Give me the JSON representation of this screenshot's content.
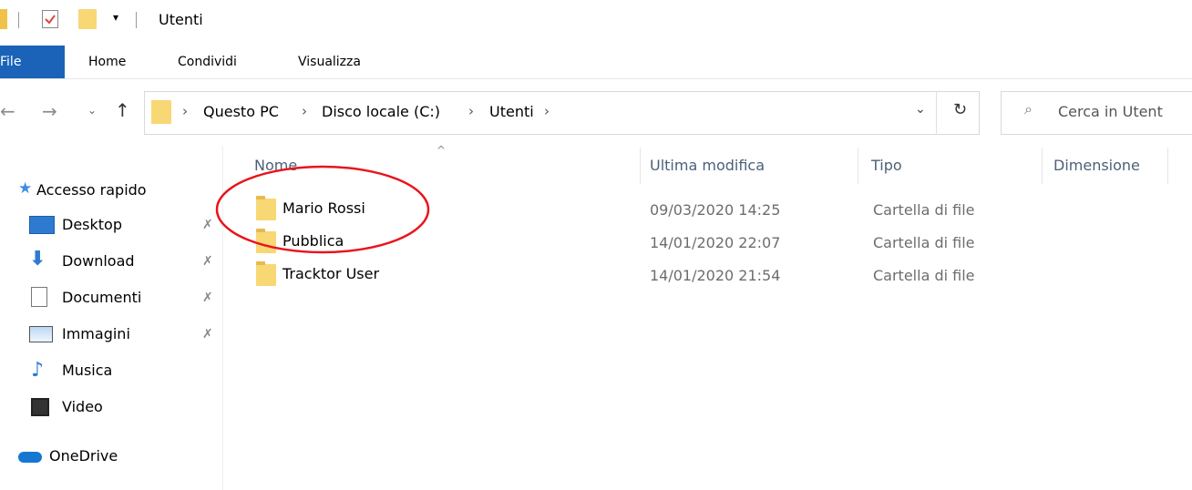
{
  "window": {
    "title": "Utenti"
  },
  "ribbon": {
    "tabs": [
      "File",
      "Home",
      "Condividi",
      "Visualizza"
    ]
  },
  "address": {
    "crumbs": [
      "Questo PC",
      "Disco locale (C:)",
      "Utenti"
    ],
    "search_placeholder": "Cerca in Utent"
  },
  "columns": [
    "Nome",
    "Ultima modifica",
    "Tipo",
    "Dimensione"
  ],
  "sidebar": {
    "quick_access": "Accesso rapido",
    "items": [
      {
        "label": "Desktop",
        "icon": "desktop-icon",
        "pinned": true
      },
      {
        "label": "Download",
        "icon": "download-icon",
        "pinned": true
      },
      {
        "label": "Documenti",
        "icon": "documents-icon",
        "pinned": true
      },
      {
        "label": "Immagini",
        "icon": "pictures-icon",
        "pinned": true
      },
      {
        "label": "Musica",
        "icon": "music-icon",
        "pinned": false
      },
      {
        "label": "Video",
        "icon": "video-icon",
        "pinned": false
      }
    ],
    "onedrive": "OneDrive"
  },
  "files": [
    {
      "name": "Mario Rossi",
      "date": "09/03/2020 14:25",
      "type": "Cartella di file"
    },
    {
      "name": "Pubblica",
      "date": "14/01/2020 22:07",
      "type": "Cartella di file"
    },
    {
      "name": "Tracktor User",
      "date": "14/01/2020 21:54",
      "type": "Cartella di file"
    }
  ],
  "colors": {
    "accent": "#1a63b8",
    "folder": "#f8d775",
    "annotation": "#e8151b"
  }
}
